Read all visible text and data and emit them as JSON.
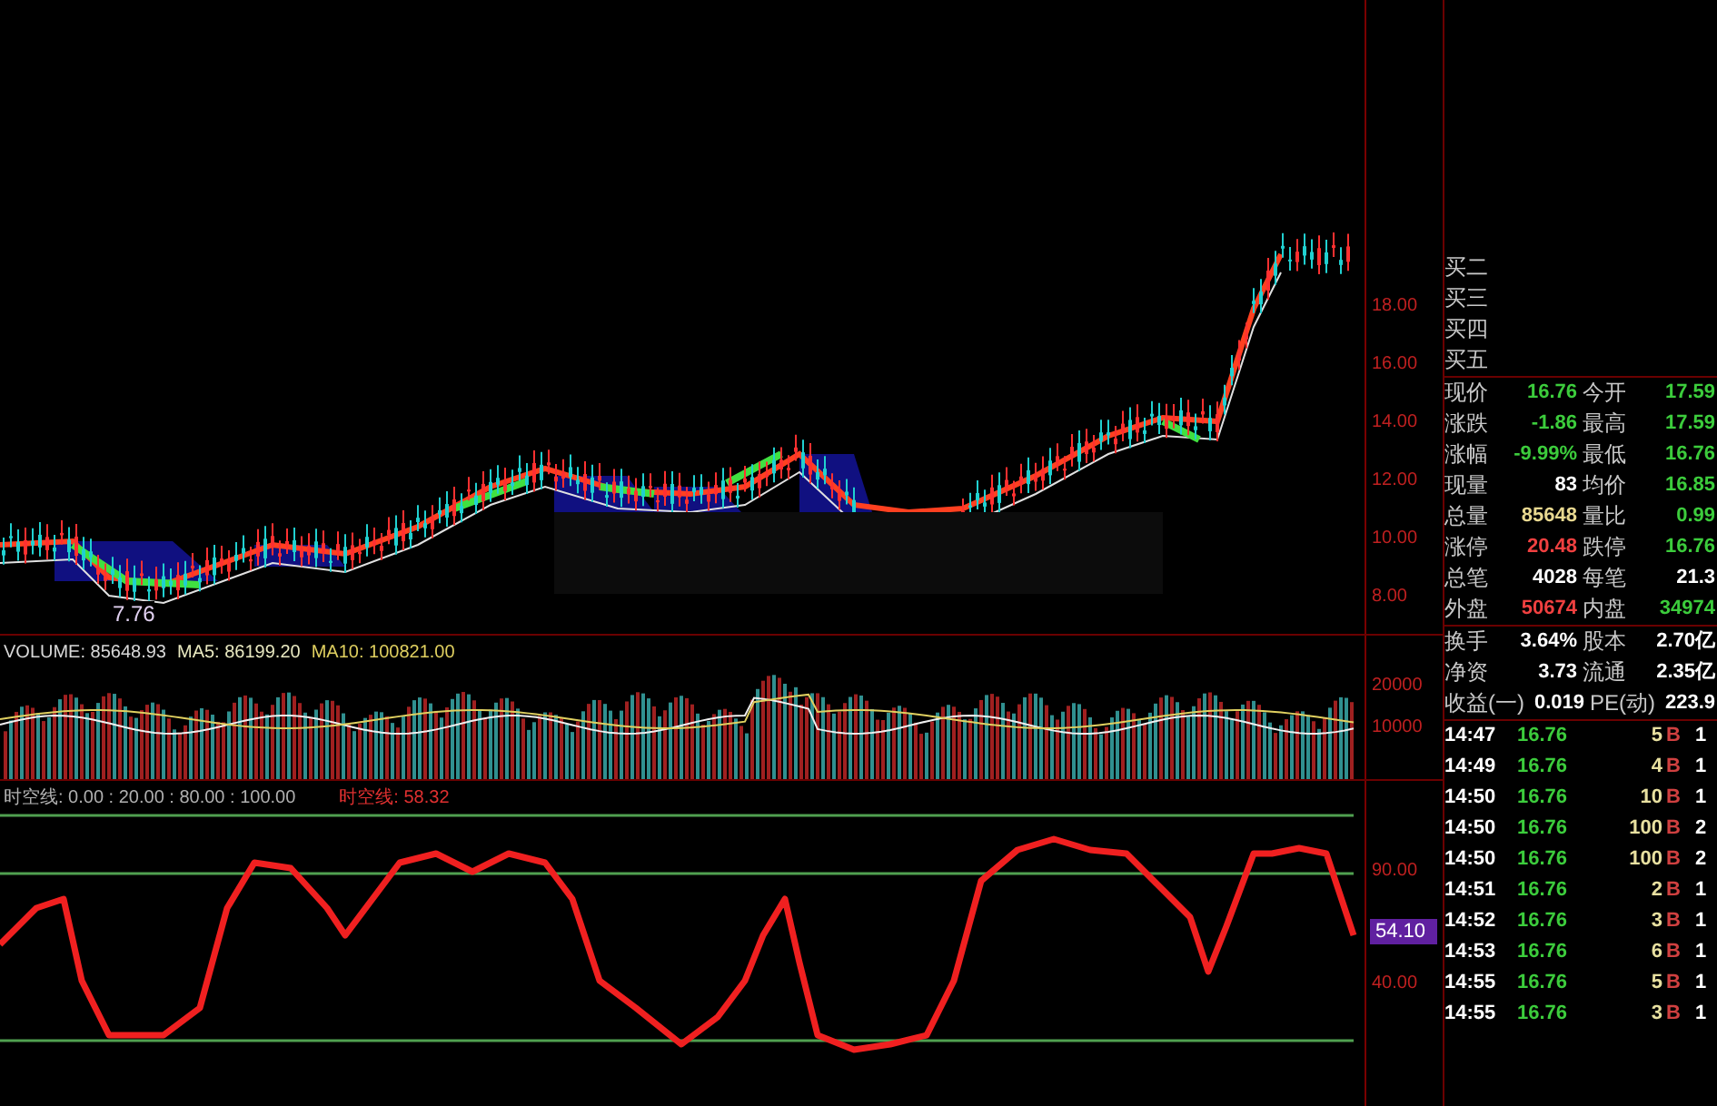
{
  "price_panel": {
    "axis_labels": [
      "18.00",
      "16.00",
      "14.00",
      "12.00",
      "10.00",
      "8.00"
    ],
    "low_label": "7.76"
  },
  "volume_panel": {
    "header": [
      {
        "text": "VOLUME: 85648.93",
        "color": "#d8d8d8"
      },
      {
        "text": "MA5: 86199.20",
        "color": "#e8e8c0"
      },
      {
        "text": "MA10: 100821.00",
        "color": "#e0d060"
      }
    ],
    "axis_labels": [
      "20000",
      "10000"
    ]
  },
  "indicator_panel": {
    "header": "时空线: 0.00 : 20.00 : 80.00 : 100.00",
    "value_label": "时空线: 58.32",
    "axis_labels": [
      "90.00",
      "40.00"
    ],
    "current_value": "54.10"
  },
  "order_book": [
    "买二",
    "买三",
    "买四",
    "买五"
  ],
  "quote": [
    {
      "items": [
        {
          "label": "现价",
          "value": "16.76",
          "color": "#3ccc3c"
        },
        {
          "label": "今开",
          "value": "17.59",
          "color": "#3ccc3c"
        }
      ]
    },
    {
      "items": [
        {
          "label": "涨跌",
          "value": "-1.86",
          "color": "#3ccc3c"
        },
        {
          "label": "最高",
          "value": "17.59",
          "color": "#3ccc3c"
        }
      ]
    },
    {
      "items": [
        {
          "label": "涨幅",
          "value": "-9.99%",
          "color": "#3ccc3c"
        },
        {
          "label": "最低",
          "value": "16.76",
          "color": "#3ccc3c"
        }
      ]
    },
    {
      "items": [
        {
          "label": "现量",
          "value": "83",
          "color": "#ffffff"
        },
        {
          "label": "均价",
          "value": "16.85",
          "color": "#3ccc3c"
        }
      ]
    },
    {
      "items": [
        {
          "label": "总量",
          "value": "85648",
          "color": "#e8d890"
        },
        {
          "label": "量比",
          "value": "0.99",
          "color": "#3ccc3c"
        }
      ]
    },
    {
      "items": [
        {
          "label": "涨停",
          "value": "20.48",
          "color": "#f04040"
        },
        {
          "label": "跌停",
          "value": "16.76",
          "color": "#3ccc3c"
        }
      ]
    },
    {
      "items": [
        {
          "label": "总笔",
          "value": "4028",
          "color": "#ffffff"
        },
        {
          "label": "每笔",
          "value": "21.3",
          "color": "#ffffff"
        }
      ]
    },
    {
      "items": [
        {
          "label": "外盘",
          "value": "50674",
          "color": "#f04040"
        },
        {
          "label": "内盘",
          "value": "34974",
          "color": "#3ccc3c"
        }
      ]
    }
  ],
  "stats": [
    {
      "items": [
        {
          "label": "换手",
          "value": "3.64%",
          "color": "#ffffff"
        },
        {
          "label": "股本",
          "value": "2.70亿",
          "color": "#ffffff"
        }
      ]
    },
    {
      "items": [
        {
          "label": "净资",
          "value": "3.73",
          "color": "#ffffff"
        },
        {
          "label": "流通",
          "value": "2.35亿",
          "color": "#ffffff"
        }
      ]
    },
    {
      "items": [
        {
          "label": "收益(一)",
          "value": "0.019",
          "color": "#ffffff"
        },
        {
          "label": "PE(动)",
          "value": "223.9",
          "color": "#ffffff"
        }
      ]
    }
  ],
  "trades": [
    {
      "time": "14:47",
      "price": "16.76",
      "volume": "5",
      "side": "B",
      "count": "1"
    },
    {
      "time": "14:49",
      "price": "16.76",
      "volume": "4",
      "side": "B",
      "count": "1"
    },
    {
      "time": "14:50",
      "price": "16.76",
      "volume": "10",
      "side": "B",
      "count": "1"
    },
    {
      "time": "14:50",
      "price": "16.76",
      "volume": "100",
      "side": "B",
      "count": "2"
    },
    {
      "time": "14:50",
      "price": "16.76",
      "volume": "100",
      "side": "B",
      "count": "2"
    },
    {
      "time": "14:51",
      "price": "16.76",
      "volume": "2",
      "side": "B",
      "count": "1"
    },
    {
      "time": "14:52",
      "price": "16.76",
      "volume": "3",
      "side": "B",
      "count": "1"
    },
    {
      "time": "14:53",
      "price": "16.76",
      "volume": "6",
      "side": "B",
      "count": "1"
    },
    {
      "time": "14:55",
      "price": "16.76",
      "volume": "5",
      "side": "B",
      "count": "1"
    },
    {
      "time": "14:55",
      "price": "16.76",
      "volume": "3",
      "side": "B",
      "count": "1"
    }
  ]
}
